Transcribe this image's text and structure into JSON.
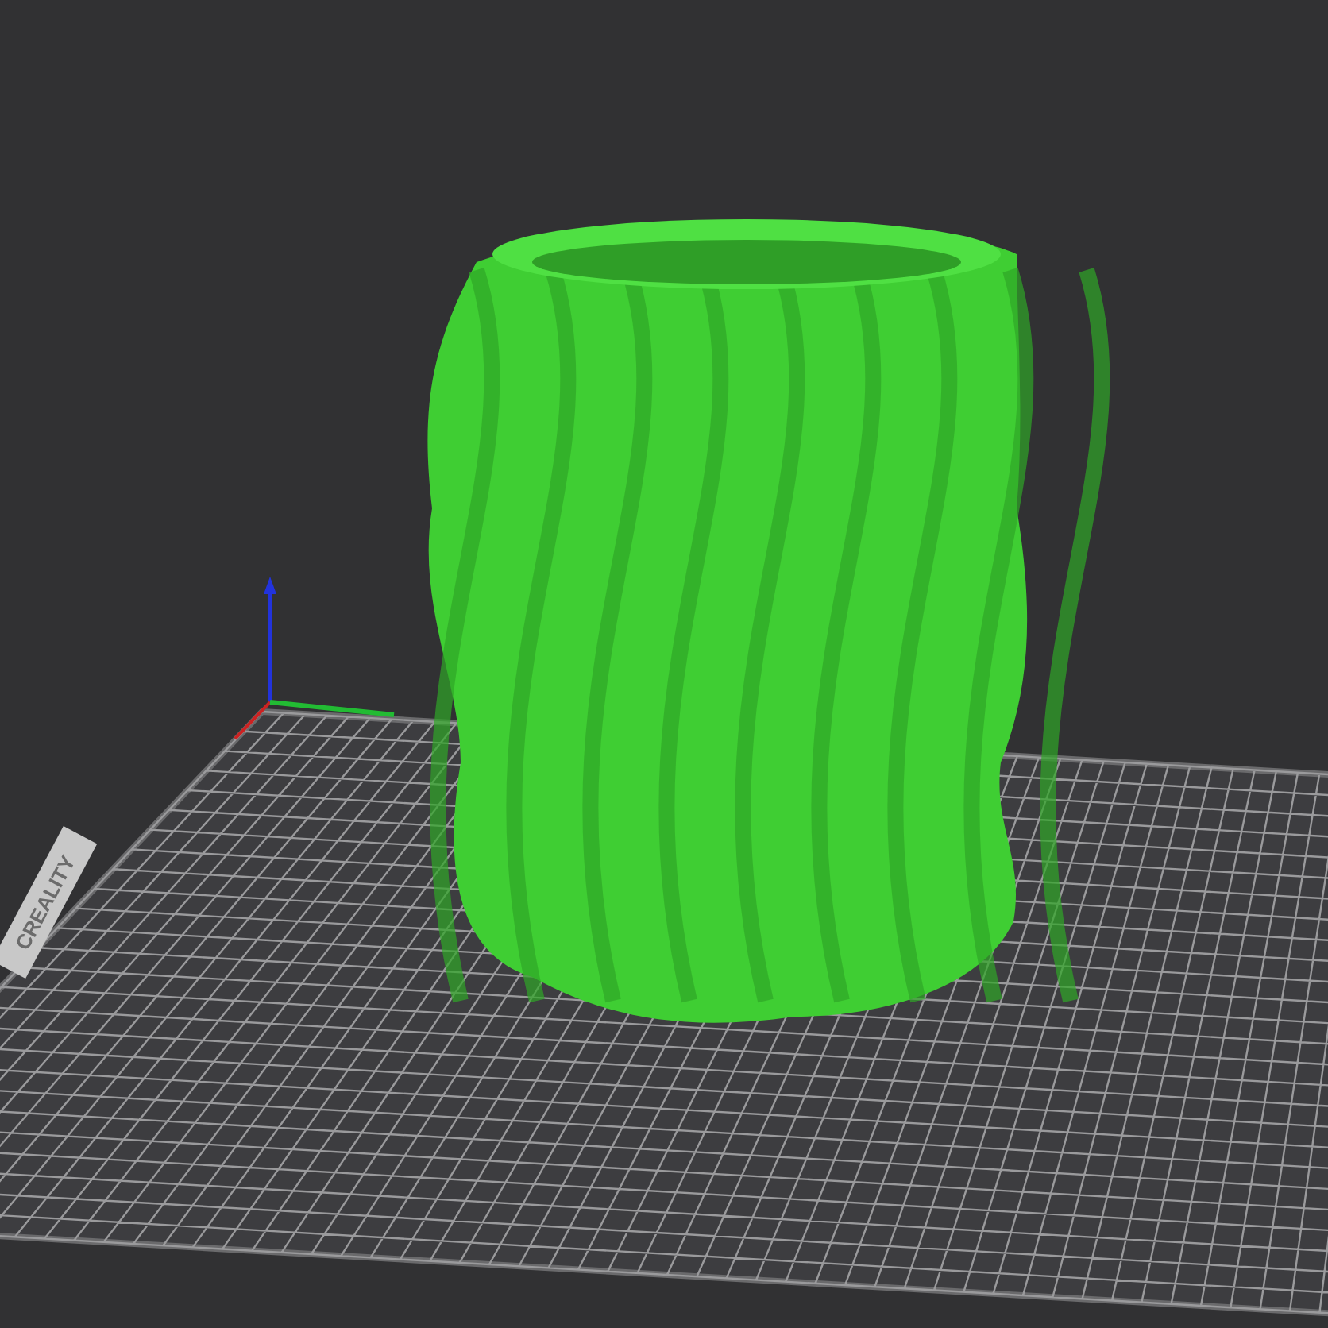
{
  "viewport": {
    "plate_logo": "CREALITY"
  }
}
